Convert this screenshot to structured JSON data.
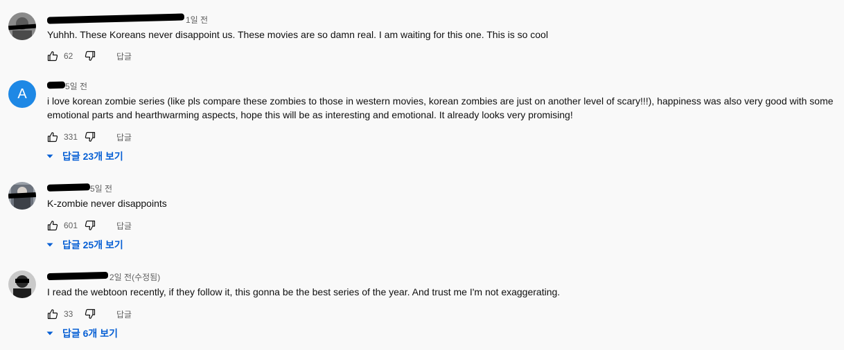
{
  "reply_label": "답글",
  "comments": [
    {
      "time": "1일 전",
      "text": "Yuhhh. These Koreans never disappoint us. These movies are so damn real. I am waiting for this one. This is so cool",
      "likes": "62"
    },
    {
      "avatar_letter": "A",
      "time": "5일 전",
      "text": "i love korean zombie series (like pls compare these zombies to those in western movies, korean zombies are just on another level of scary!!!), happiness was also very good with some emotional parts and hearthwarming aspects, hope this will be as interesting and emotional. It already looks very promising!",
      "likes": "331",
      "replies": "답글 23개 보기"
    },
    {
      "time": "5일 전",
      "text": "K-zombie never disappoints",
      "likes": "601",
      "replies": "답글 25개 보기"
    },
    {
      "time": "2일 전(수정됨)",
      "text": "I read the webtoon recently, if they follow it, this gonna be the best series of the year. And trust me I'm not exaggerating.",
      "likes": "33",
      "replies": "답글 6개 보기"
    }
  ]
}
